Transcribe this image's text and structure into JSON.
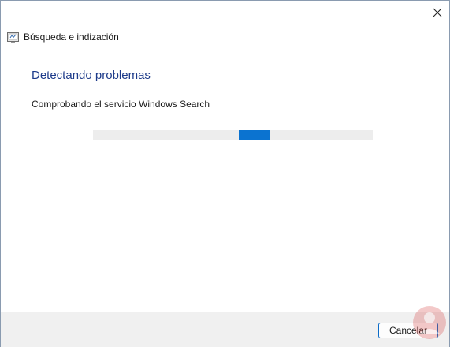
{
  "window": {
    "title": "Búsqueda e indización"
  },
  "main": {
    "heading": "Detectando problemas",
    "status": "Comprobando el servicio Windows Search",
    "progress": {
      "mode": "indeterminate",
      "segment_start_fraction": 0.52,
      "segment_end_fraction": 0.63
    }
  },
  "footer": {
    "cancel_label": "Cancelar"
  },
  "colors": {
    "heading": "#1c3a8a",
    "progress_fill": "#0b73d0",
    "progress_track": "#ededed",
    "footer_bg": "#f0f0f0",
    "button_border": "#0b6bc7"
  },
  "icons": {
    "close": "close-icon",
    "app": "troubleshooter-icon"
  }
}
